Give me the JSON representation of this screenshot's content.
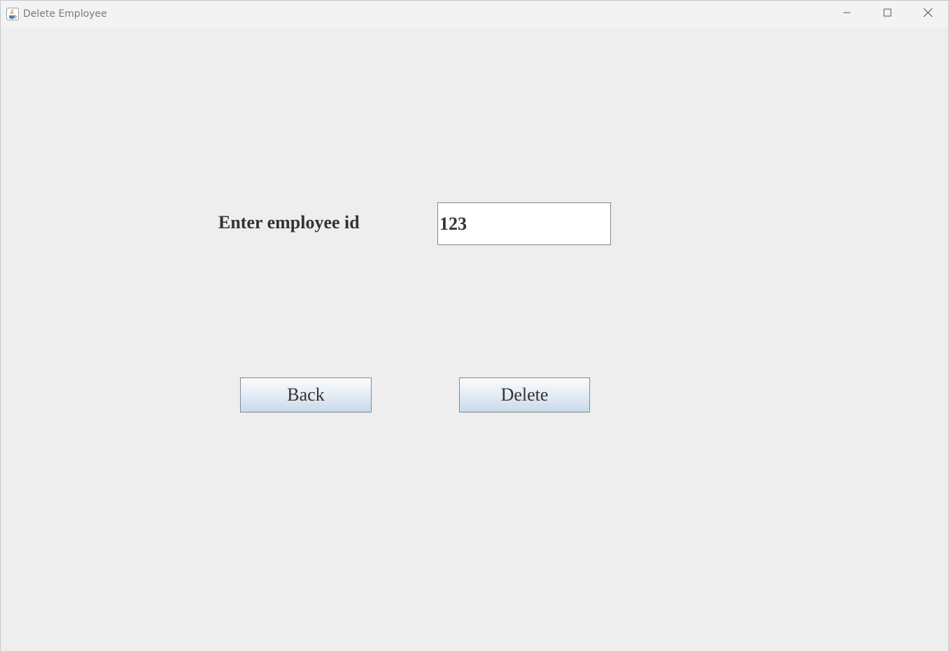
{
  "window": {
    "title": "Delete Employee",
    "app_icon": "java-cup-icon",
    "controls": {
      "minimize_icon": "minimize-icon",
      "maximize_icon": "maximize-icon",
      "close_icon": "close-icon"
    }
  },
  "form": {
    "id_label": "Enter employee id",
    "id_value": "123"
  },
  "buttons": {
    "back_label": "Back",
    "delete_label": "Delete"
  },
  "colors": {
    "background": "#eeeeee",
    "text": "#333333",
    "button_gradient_top": "#fbfcfd",
    "button_gradient_bottom": "#c9daea",
    "border": "#7a8a99"
  }
}
